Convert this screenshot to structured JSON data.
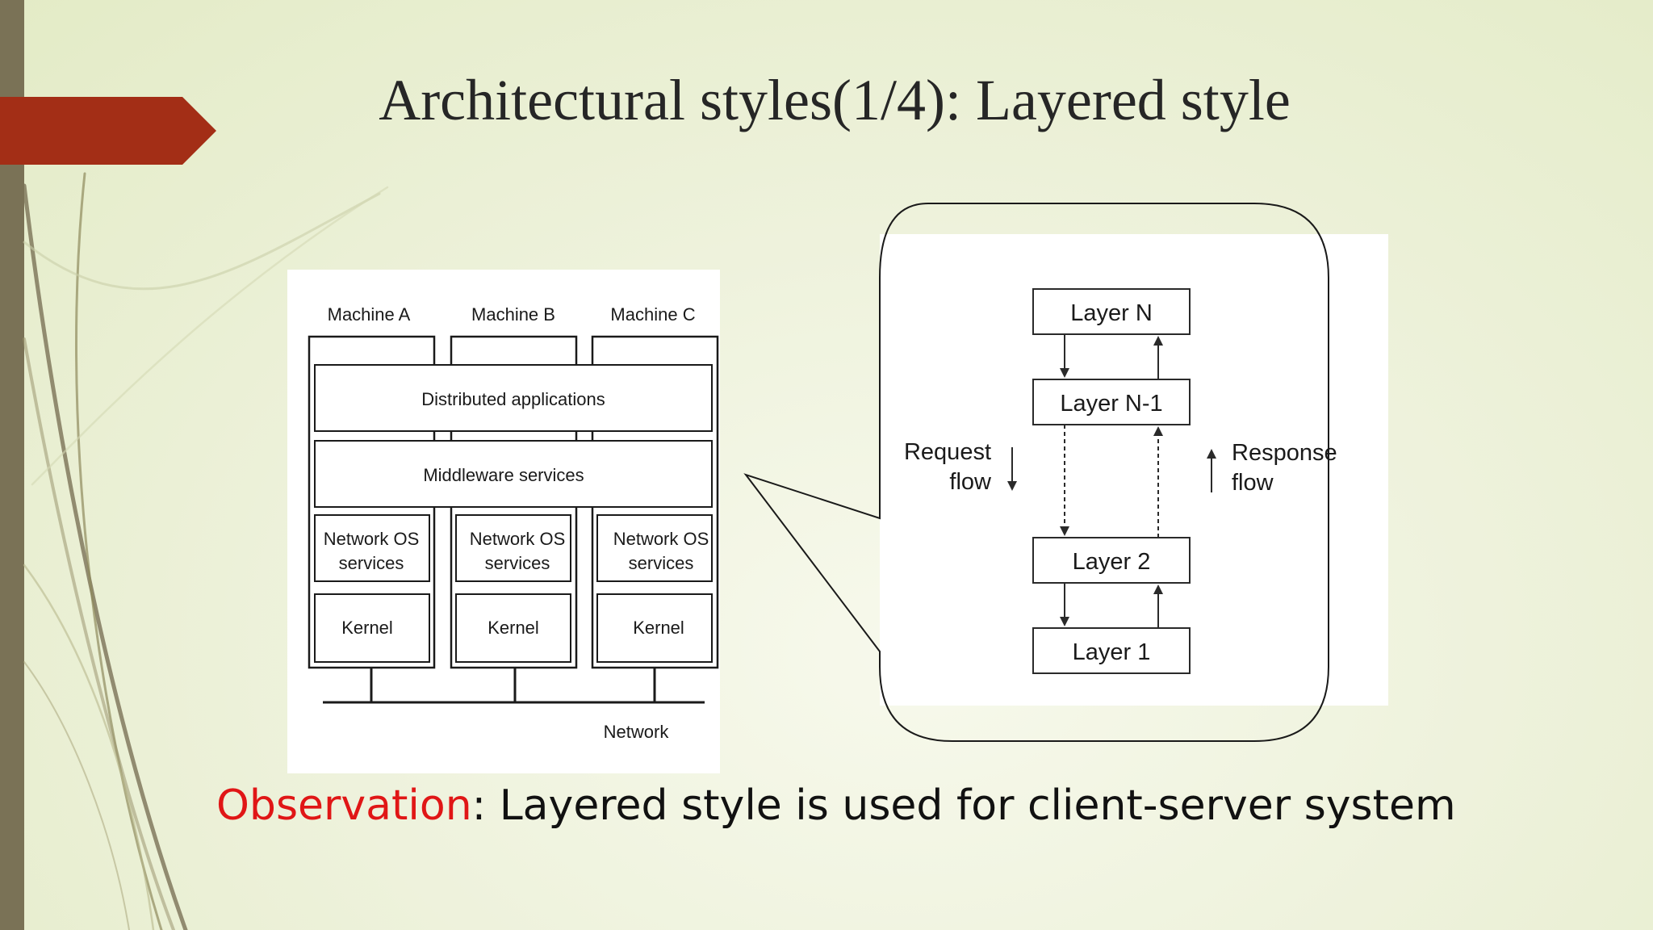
{
  "slide": {
    "title": "Architectural styles(1/4): Layered style",
    "observation_key": "Observation",
    "observation_text": ": Layered style is used for client-server system"
  },
  "distributed_diagram": {
    "machines": [
      "Machine A",
      "Machine B",
      "Machine C"
    ],
    "distributed_applications": "Distributed applications",
    "middleware_services": "Middleware services",
    "network_os_line1": "Network OS",
    "network_os_line2": "services",
    "kernel": "Kernel",
    "network": "Network"
  },
  "layered_diagram": {
    "layers": [
      "Layer N",
      "Layer N-1",
      "Layer 2",
      "Layer 1"
    ],
    "request_line1": "Request",
    "request_line2": "flow",
    "response_line1": "Response",
    "response_line2": "flow"
  },
  "colors": {
    "accent_red": "#a32e16",
    "left_bar": "#7a7256",
    "observation_key": "#e01616"
  }
}
